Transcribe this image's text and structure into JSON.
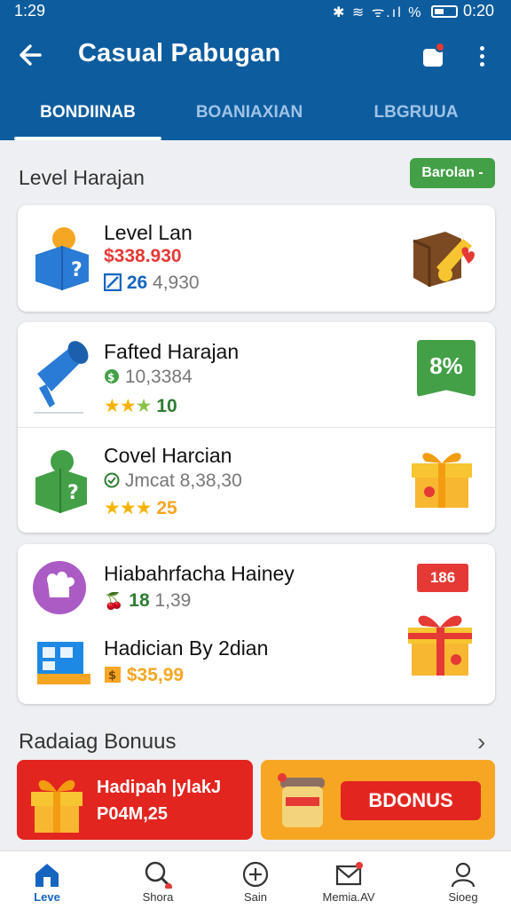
{
  "status": {
    "time": "1:29",
    "icons": "✱ ≋ ᯤ.ıl %",
    "clock2": "0:20"
  },
  "header": {
    "title": "Casual Pabugan"
  },
  "tabs": [
    {
      "label": "BONDIINAB",
      "active": true
    },
    {
      "label": "BOANIAXIAN",
      "active": false
    },
    {
      "label": "LBGRUUA",
      "active": false
    }
  ],
  "section": {
    "title": "Level Harajan",
    "pill": "Barolan -"
  },
  "card1": {
    "title": "Level Lan",
    "price": "$338.930",
    "count": "26",
    "count_rest": "4,930"
  },
  "card2": {
    "item1": {
      "title": "Fafted Harajan",
      "value": "10,3384",
      "rating": "10",
      "badge": "8%"
    },
    "item2": {
      "title": "Covel Harcian",
      "value": "Jmcat 8,38,30",
      "rating": "25"
    }
  },
  "card3": {
    "item1": {
      "title": "Hiabahrfacha Hainey",
      "value_bold": "18",
      "value_rest": "1,39",
      "badge": "186"
    },
    "item2": {
      "title": "Hadician By 2dian",
      "value": "$35,99"
    }
  },
  "bonus": {
    "title": "Radaiag Bonuus",
    "promo1_line1": "Hadipah |ylakJ",
    "promo1_line2": "P04M,25",
    "promo2_button": "BDONUS"
  },
  "bottom_nav": [
    {
      "label": "Leve",
      "icon": "home-icon",
      "active": true
    },
    {
      "label": "Shora",
      "icon": "search-icon",
      "active": false
    },
    {
      "label": "Sain",
      "icon": "plus-circle-icon",
      "active": false
    },
    {
      "label": "Memia.AV",
      "icon": "mail-icon",
      "active": false
    },
    {
      "label": "Sioeg",
      "icon": "profile-icon",
      "active": false
    }
  ],
  "colors": {
    "primary": "#0d5c9e",
    "accent_green": "#43a047",
    "accent_red": "#e53935",
    "promo_orange": "#f6a623"
  }
}
